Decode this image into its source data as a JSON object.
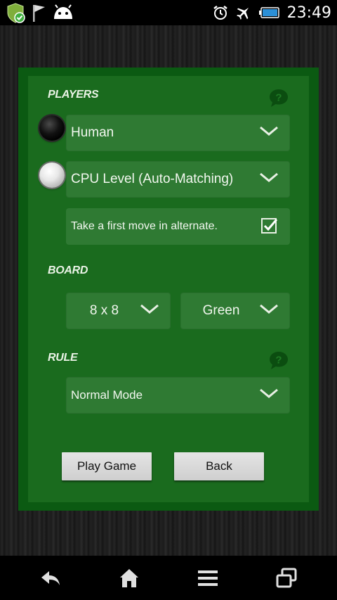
{
  "status_bar": {
    "time": "23:49",
    "left_icons": [
      "shield-check-icon",
      "flag-icon",
      "android-icon"
    ],
    "right_icons": [
      "alarm-icon",
      "airplane-icon",
      "battery-icon"
    ]
  },
  "players": {
    "section_label": "PLAYERS",
    "player1": {
      "value": "Human",
      "stone": "black"
    },
    "player2": {
      "value": "CPU Level (Auto-Matching)",
      "stone": "white"
    },
    "alternate_first_move": {
      "label": "Take a first move in alternate.",
      "checked": true
    }
  },
  "board": {
    "section_label": "BOARD",
    "size_value": "8 x 8",
    "color_value": "Green"
  },
  "rule": {
    "section_label": "RULE",
    "mode_value": "Normal Mode"
  },
  "actions": {
    "play_label": "Play Game",
    "back_label": "Back"
  },
  "nav": [
    "back-icon",
    "home-icon",
    "menu-icon",
    "recent-apps-icon"
  ],
  "colors": {
    "panel_outer": "#0b5a12",
    "panel_inner": "#1a6b1e",
    "field": "#2f7a33",
    "help_icon": "#0b4d10"
  }
}
